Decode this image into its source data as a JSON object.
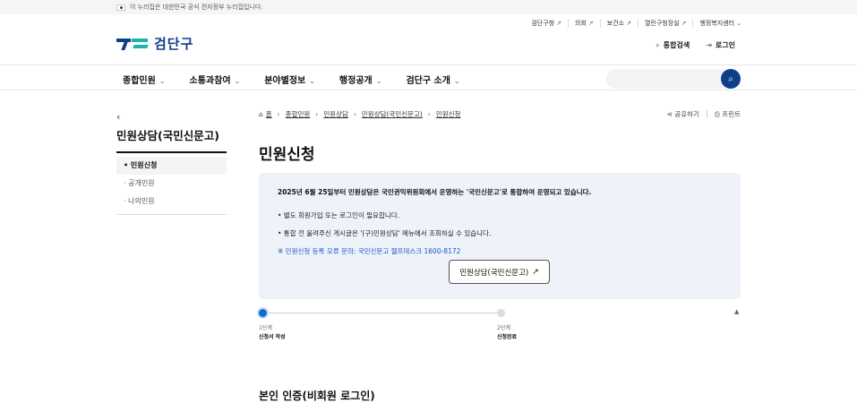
{
  "gov_banner": {
    "text": "이 누리집은 대한민국 공식 전자정부 누리집입니다."
  },
  "utility": [
    {
      "label": "검단구청",
      "external": true
    },
    {
      "label": "의회",
      "external": true
    },
    {
      "label": "보건소",
      "external": true
    },
    {
      "label": "열린구청장실",
      "external": true
    },
    {
      "label": "행정복지센터",
      "dropdown": true
    }
  ],
  "logo": {
    "text": "검단구",
    "colors": {
      "navy": "#0d3f8a",
      "teal": "#1eb3a6"
    }
  },
  "top_actions": {
    "search": "통합검색",
    "login": "로그인"
  },
  "gnb": {
    "items": [
      "종합민원",
      "소통과참여",
      "분야별정보",
      "행정공개",
      "검단구 소개"
    ]
  },
  "sidebar": {
    "title": "민원상담(국민신문고)",
    "items": [
      {
        "label": "민원신청",
        "active": true
      },
      {
        "label": "공개민원",
        "active": false
      },
      {
        "label": "나의민원",
        "active": false
      }
    ]
  },
  "breadcrumb": {
    "home": "홈",
    "items": [
      "종합민원",
      "민원상담",
      "민원상담(국민신문고)",
      "민원신청"
    ]
  },
  "share": {
    "share": "공유하기",
    "print": "프린트"
  },
  "page_title": "민원신청",
  "notice": {
    "title": "2025년 6월 25일부터 민원상담은 국민권익위원회에서 운영하는 '국민신문고'로 통합하여 운영되고 있습니다.",
    "line1": "• 별도 회원가입 또는 로그인이 필요합니다.",
    "line2": "• 통합 전 올려주신 게시글은 '(구)민원상담' 메뉴에서 조회하실 수 있습니다.",
    "contact": "※ 민원신청 등록 오류 문의: 국민신문고 헬프데스크 1600-8172",
    "button": "민원상담(국민신문고)"
  },
  "steps": [
    {
      "num": "1단계",
      "name": "신청서 작성",
      "active": true
    },
    {
      "num": "2단계",
      "name": "신청완료",
      "active": false
    }
  ],
  "section_title": "본인 인증(비회원 로그인)",
  "colors": {
    "primary": "#0d3f8a",
    "notice_bg": "#eef3f9",
    "link_blue": "#1a56c4",
    "step_active": "#0d6bd6"
  }
}
